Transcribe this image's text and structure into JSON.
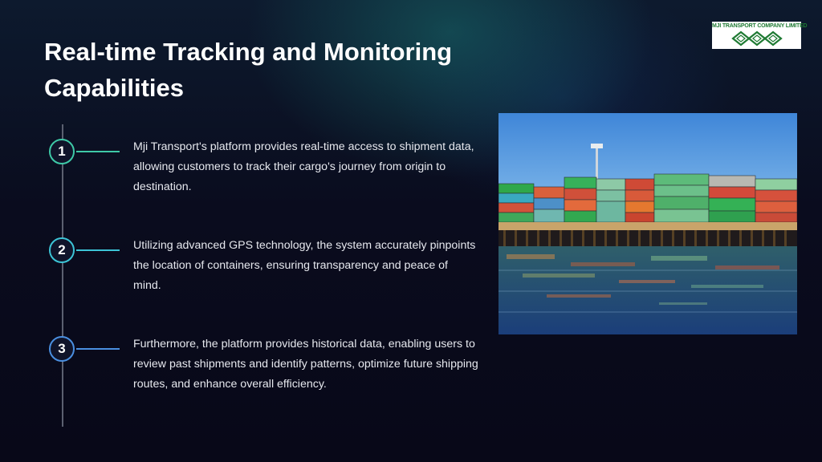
{
  "slide": {
    "title": "Real-time Tracking and Monitoring Capabilities"
  },
  "logo": {
    "text": "MJI TRANSPORT COMPANY LIMITED",
    "color": "#1f7a33"
  },
  "steps": [
    {
      "number": "1",
      "text": "Mji Transport's platform provides real-time access to shipment data, allowing customers to track their cargo's journey from origin to destination.",
      "accent": "#3ec9a7"
    },
    {
      "number": "2",
      "text": "Utilizing advanced GPS technology, the system accurately pinpoints the location of containers, ensuring transparency and peace of mind.",
      "accent": "#3cc4d6"
    },
    {
      "number": "3",
      "text": "Furthermore, the platform provides historical data, enabling users to review past shipments and identify patterns, optimize future shipping routes, and enhance overall efficiency.",
      "accent": "#4a8fe0"
    }
  ],
  "photo": {
    "subject": "container-port-image"
  }
}
